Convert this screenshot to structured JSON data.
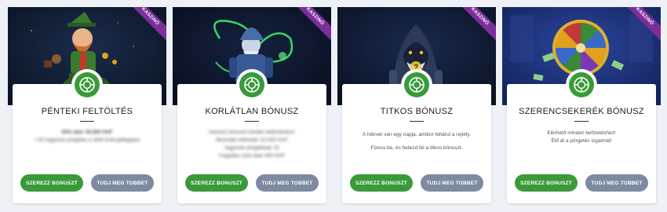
{
  "cards": [
    {
      "badge": "KASZINÓ",
      "title": "PÉNTEKI FELTÖLTÉS",
      "desc_blurred": true,
      "desc": [
        "50% akár 35,000 HUF",
        "+ 50 ingyenes pörgetés a Wolf Gold játékgépre"
      ],
      "primary": "SZEREZZ BONUSZT",
      "secondary": "TUDJ MEG TOBBET",
      "banner_icon": "leprechaun-icon"
    },
    {
      "badge": "KASZINÓ",
      "title": "KORLÁTLAN BÓNUSZ",
      "desc_blurred": true,
      "desc": [
        "Szerezz bónuszt minden befizetéskor!",
        "Minimális befizetés 10,000 HUF",
        "Ingyenes pörgetések 15",
        "Fogadási szint akár 400 HUF"
      ],
      "primary": "SZEREZZ BONUSZT",
      "secondary": "TUDJ MEG TOBBET",
      "banner_icon": "wizard-icon"
    },
    {
      "badge": "KASZINÓ",
      "title": "TITKOS BÓNUSZ",
      "desc_blurred": false,
      "desc": [
        "A hétnek van egy napja, amikor feltárul a rejtély.",
        "Fizess be, és fedezd fel a titkos bónuszt."
      ],
      "primary": "SZEREZZ BONUSZT",
      "secondary": "TUDJ MEG TOBBET",
      "banner_icon": "hooded-mage-icon"
    },
    {
      "badge": "KASZINÓ",
      "title": "SZERENCSEKERÉK BÓNUSZ",
      "desc_blurred": false,
      "desc": [
        "Elérhető minden befizetéshez!",
        "Élđ át a pörgetés izgalmát!"
      ],
      "primary": "SZEREZZ BONUSZT",
      "secondary": "TUDJ MEG TOBBET",
      "banner_icon": "fortune-wheel-icon"
    }
  ],
  "colors": {
    "primary_button": "#3a9a3a",
    "secondary_button": "#7d8aa2",
    "badge_ribbon": "#7b2f9a",
    "card_bg": "#ffffff",
    "page_bg": "#eef1f5"
  }
}
